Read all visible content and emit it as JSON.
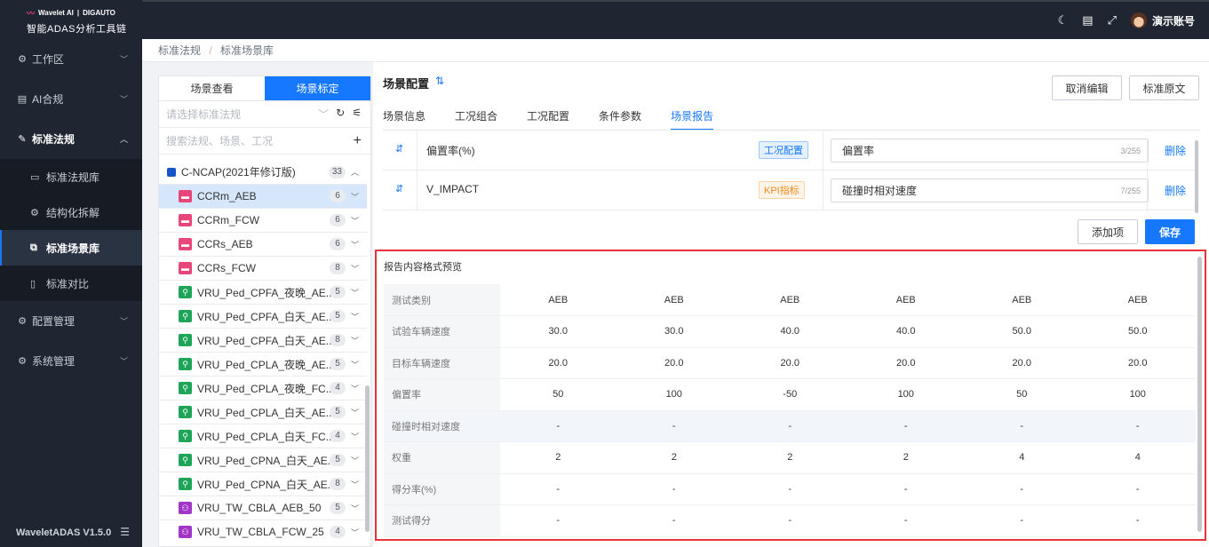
{
  "brand": {
    "logo_line1_a": "Wavelet AI",
    "logo_line1_b": "DIGAUTO",
    "logo_line2": "智能ADAS分析工具链"
  },
  "sidebar": {
    "items": [
      {
        "label": "工作区",
        "icon": "gear-icon"
      },
      {
        "label": "AI合规",
        "icon": "document-icon"
      },
      {
        "label": "标准法规",
        "icon": "edit-icon"
      },
      {
        "label": "配置管理",
        "icon": "gear-icon"
      },
      {
        "label": "系统管理",
        "icon": "gear-icon"
      }
    ],
    "sub_items": [
      {
        "label": "标准法规库"
      },
      {
        "label": "结构化拆解"
      },
      {
        "label": "标准场景库"
      },
      {
        "label": "标准对比"
      }
    ],
    "version": "WaveletADAS  V1.5.0"
  },
  "header": {
    "account": "演示账号"
  },
  "breadcrumb": {
    "first": "标准法规",
    "sep": "/",
    "second": "标准场景库"
  },
  "left_panel": {
    "tabs": [
      "场景查看",
      "场景标定"
    ],
    "select_placeholder": "请选择标准法规",
    "search_placeholder": "搜索法规、场景、工况",
    "root": {
      "label": "C-NCAP(2021年修订版)",
      "count": "33"
    },
    "items": [
      {
        "label": "CCRm_AEB",
        "count": "6",
        "kind": "car"
      },
      {
        "label": "CCRm_FCW",
        "count": "6",
        "kind": "car"
      },
      {
        "label": "CCRs_AEB",
        "count": "6",
        "kind": "car"
      },
      {
        "label": "CCRs_FCW",
        "count": "8",
        "kind": "car"
      },
      {
        "label": "VRU_Ped_CPFA_夜晚_AE...",
        "count": "5",
        "kind": "ped"
      },
      {
        "label": "VRU_Ped_CPFA_白天_AE...",
        "count": "5",
        "kind": "ped"
      },
      {
        "label": "VRU_Ped_CPFA_白天_AE...",
        "count": "8",
        "kind": "ped"
      },
      {
        "label": "VRU_Ped_CPLA_夜晚_AE...",
        "count": "5",
        "kind": "ped"
      },
      {
        "label": "VRU_Ped_CPLA_夜晚_FC...",
        "count": "4",
        "kind": "ped"
      },
      {
        "label": "VRU_Ped_CPLA_白天_AE...",
        "count": "5",
        "kind": "ped"
      },
      {
        "label": "VRU_Ped_CPLA_白天_FC...",
        "count": "4",
        "kind": "ped"
      },
      {
        "label": "VRU_Ped_CPNA_白天_AE...",
        "count": "5",
        "kind": "ped"
      },
      {
        "label": "VRU_Ped_CPNA_白天_AE...",
        "count": "8",
        "kind": "ped"
      },
      {
        "label": "VRU_TW_CBLA_AEB_50",
        "count": "5",
        "kind": "bike"
      },
      {
        "label": "VRU_TW_CBLA_FCW_25",
        "count": "4",
        "kind": "bike"
      }
    ]
  },
  "main": {
    "title": "场景配置",
    "cancel_label": "取消编辑",
    "original_label": "标准原文",
    "tabs": [
      "场景信息",
      "工况组合",
      "工况配置",
      "条件参数",
      "场景报告"
    ],
    "rows": [
      {
        "name": "偏置率(%)",
        "tag": "工况配置",
        "value": "偏置率",
        "count": "3/255",
        "action": "删除"
      },
      {
        "name": "V_IMPACT",
        "tag": "KPI指标",
        "value": "碰撞时相对速度",
        "count": "7/255",
        "action": "删除"
      }
    ],
    "add_label": "添加项",
    "save_label": "保存",
    "preview": {
      "title": "报告内容格式预览",
      "rows": [
        {
          "label": "测试类别",
          "values": [
            "AEB",
            "AEB",
            "AEB",
            "AEB",
            "AEB",
            "AEB"
          ]
        },
        {
          "label": "试验车辆速度",
          "values": [
            "30.0",
            "30.0",
            "40.0",
            "40.0",
            "50.0",
            "50.0"
          ]
        },
        {
          "label": "目标车辆速度",
          "values": [
            "20.0",
            "20.0",
            "20.0",
            "20.0",
            "20.0",
            "20.0"
          ]
        },
        {
          "label": "偏置率",
          "values": [
            "50",
            "100",
            "-50",
            "100",
            "50",
            "100"
          ]
        },
        {
          "label": "碰撞时相对速度",
          "values": [
            "-",
            "-",
            "-",
            "-",
            "-",
            "-"
          ]
        },
        {
          "label": "权重",
          "values": [
            "2",
            "2",
            "2",
            "2",
            "4",
            "4"
          ]
        },
        {
          "label": "得分率(%)",
          "values": [
            "-",
            "-",
            "-",
            "-",
            "-",
            "-"
          ]
        },
        {
          "label": "测试得分",
          "values": [
            "-",
            "-",
            "-",
            "-",
            "-",
            "-"
          ]
        }
      ]
    }
  },
  "colors": {
    "accent": "#1677ff",
    "sidebar_bg": "#1f2631",
    "highlight_border": "#e8333a"
  }
}
